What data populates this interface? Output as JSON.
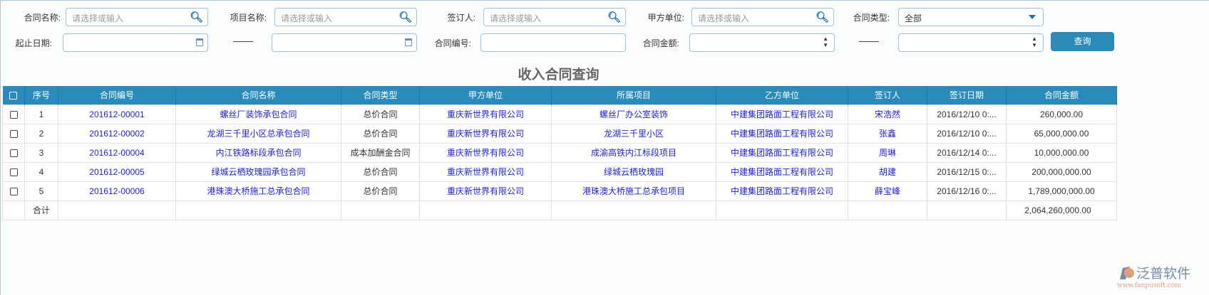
{
  "filters": {
    "contract_name": {
      "label": "合同名称:",
      "placeholder": "请选择或输入"
    },
    "project_name": {
      "label": "项目名称:",
      "placeholder": "请选择或输入"
    },
    "signer": {
      "label": "签订人:",
      "placeholder": "请选择或输入"
    },
    "party_a": {
      "label": "甲方单位:",
      "placeholder": "请选择或输入"
    },
    "contract_type": {
      "label": "合同类型:",
      "value": "全部"
    },
    "date_range": {
      "label": "起止日期:",
      "separator": "——"
    },
    "contract_no": {
      "label": "合同编号:"
    },
    "amount": {
      "label": "合同金额:",
      "separator": "——"
    },
    "query_button": "查询"
  },
  "page_title": "收入合同查询",
  "table": {
    "headers": [
      "序号",
      "合同编号",
      "合同名称",
      "合同类型",
      "甲方单位",
      "所属项目",
      "乙方单位",
      "签订人",
      "签订日期",
      "合同金额"
    ],
    "rows": [
      [
        "1",
        "201612-00001",
        "螺丝厂装饰承包合同",
        "总价合同",
        "重庆新世界有限公司",
        "螺丝厂办公室装饰",
        "中建集团路面工程有限公司",
        "宋浩然",
        "2016/12/10 0:...",
        "260,000.00"
      ],
      [
        "2",
        "201612-00002",
        "龙湖三千里小区总承包合同",
        "总价合同",
        "重庆新世界有限公司",
        "龙湖三千里小区",
        "中建集团路面工程有限公司",
        "张鑫",
        "2016/12/10 0:...",
        "65,000,000.00"
      ],
      [
        "3",
        "201612-00004",
        "内江铁路标段承包合同",
        "成本加酬金合同",
        "重庆新世界有限公司",
        "成渝高铁内江标段项目",
        "中建集团路面工程有限公司",
        "周琳",
        "2016/12/14 0:...",
        "10,000,000.00"
      ],
      [
        "4",
        "201612-00005",
        "绿城云栖玫瑰园承包合同",
        "总价合同",
        "重庆新世界有限公司",
        "绿城云栖玫瑰园",
        "中建集团路面工程有限公司",
        "胡建",
        "2016/12/15 0:...",
        "200,000,000.00"
      ],
      [
        "5",
        "201612-00006",
        "港珠澳大桥施工总承包合同",
        "总价合同",
        "重庆新世界有限公司",
        "港珠澳大桥施工总承包项目",
        "中建集团路面工程有限公司",
        "薛宝峰",
        "2016/12/16 0:...",
        "1,789,000,000.00"
      ]
    ],
    "total_label": "合计",
    "total_amount": "2,064,260,000.00"
  },
  "logo": {
    "text": "泛普软件",
    "url": "www.fanpusoft.com"
  },
  "colors": {
    "header": "#2a8bbb",
    "link": "#2020d0"
  }
}
